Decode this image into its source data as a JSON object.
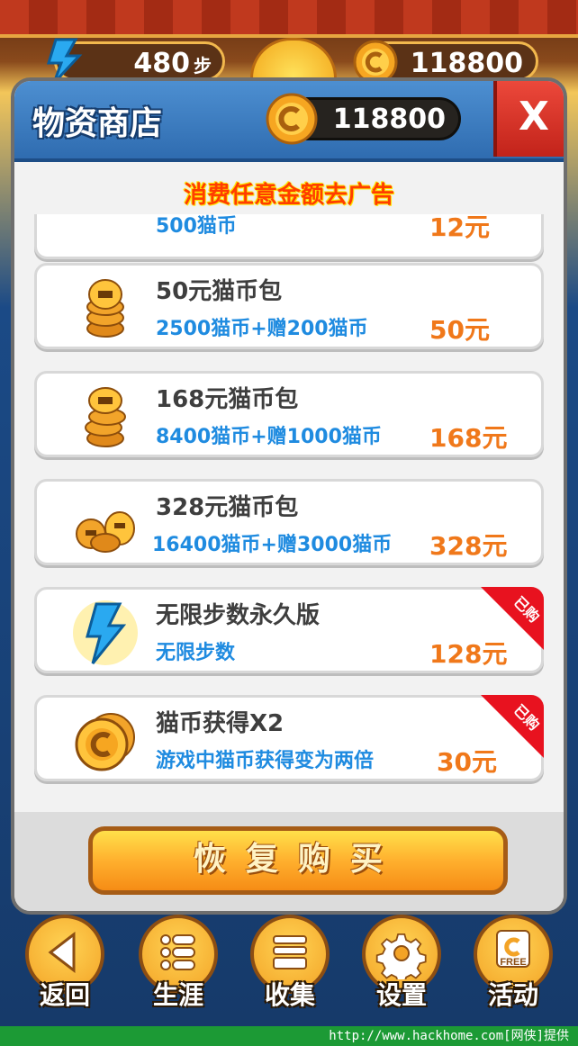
{
  "topbar": {
    "steps_value": "480",
    "steps_unit": "步",
    "coins_value": "118800"
  },
  "dialog": {
    "title": "物资商店",
    "coin_balance": "118800",
    "close_label": "X",
    "promo_text": "消费任意金额去广告",
    "partial_item": {
      "desc": "500猫币",
      "price": "12元"
    },
    "items": [
      {
        "name": "50元猫币包",
        "desc": "2500猫币+赠200猫币",
        "price": "50元",
        "icon": "coin-stack-icon",
        "purchased": false
      },
      {
        "name": "168元猫币包",
        "desc": "8400猫币+赠1000猫币",
        "price": "168元",
        "icon": "coin-stack-icon",
        "purchased": false
      },
      {
        "name": "328元猫币包",
        "desc": "16400猫币+赠3000猫币",
        "price": "328元",
        "icon": "coin-pile-icon",
        "purchased": false
      },
      {
        "name": "无限步数永久版",
        "desc": "无限步数",
        "price": "128元",
        "icon": "lightning-icon",
        "purchased": true,
        "badge": "已购"
      },
      {
        "name": "猫币获得X2",
        "desc": "游戏中猫币获得变为两倍",
        "price": "30元",
        "icon": "double-coin-icon",
        "purchased": true,
        "badge": "已购"
      }
    ],
    "restore_label": "恢复购买"
  },
  "nav": [
    {
      "label": "返回",
      "icon": "back-arrow-icon"
    },
    {
      "label": "生涯",
      "icon": "list-icon"
    },
    {
      "label": "收集",
      "icon": "gift-box-icon"
    },
    {
      "label": "设置",
      "icon": "gear-icon"
    },
    {
      "label": "活动",
      "icon": "free-coin-icon",
      "icon_text": "FREE"
    }
  ],
  "watermark": "http://www.hackhome.com[网侠]提供",
  "colors": {
    "accent_blue": "#2f6cb0",
    "price_orange": "#f0781a",
    "desc_blue": "#1f8be0",
    "badge_red": "#e8121f",
    "restore_orange": "#ffb02e"
  }
}
